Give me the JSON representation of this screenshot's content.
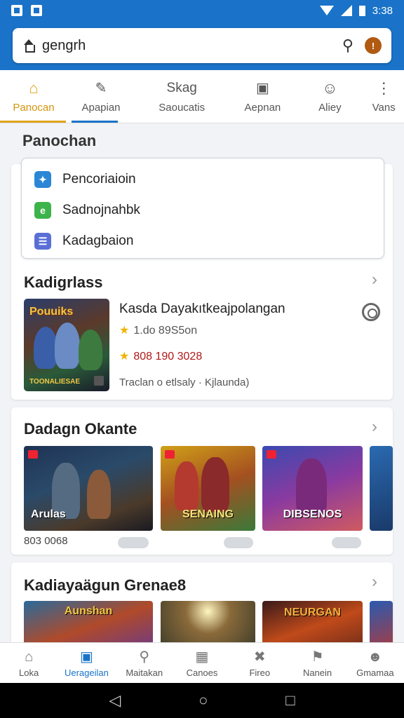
{
  "status_bar": {
    "time": "3:38"
  },
  "search": {
    "value": "gengrh"
  },
  "tabs": [
    {
      "label": "Panocan",
      "icon": "home-icon"
    },
    {
      "label": "Apapian",
      "icon": "doc-edit-icon"
    },
    {
      "label": "Saoucatis",
      "heading": "Skag",
      "icon": "text-icon"
    },
    {
      "label": "Aepnan",
      "icon": "square-icon"
    },
    {
      "label": "Aliey",
      "icon": "smile-icon"
    },
    {
      "label": "Vans",
      "icon": "more-vert-icon"
    }
  ],
  "section_title": "Panochan",
  "menu": [
    {
      "label": "Pencoriaioin",
      "color": "#2b86d6",
      "icon": "app-icon"
    },
    {
      "label": "Sadnojnahbk",
      "color": "#3cb44b",
      "icon": "chat-icon"
    },
    {
      "label": "Kadagbaion",
      "color": "#5a6fd6",
      "icon": "list-icon"
    }
  ],
  "featured": {
    "section": "Kadigrlass",
    "image_title": "Pouuiks",
    "image_bottom": "TOONALIESAE",
    "name": "Kasda Dayakıtkeajpolangan",
    "rating": "1.do 89S5on",
    "price": "808 190 3028",
    "meta": "Traclan o etlsaly · Kjlaunda)"
  },
  "row2": {
    "title": "Dadagn Okante",
    "value": "803 0068",
    "tiles": [
      {
        "title": "Arulas"
      },
      {
        "title": "SENAING"
      },
      {
        "title": "DIBSENOS"
      }
    ]
  },
  "row3": {
    "title": "Kadiayaägun Grenae8",
    "tiles": [
      {
        "title": "Aunshan"
      },
      {
        "title": ""
      },
      {
        "title": "NEURGAN"
      }
    ]
  },
  "bottom_nav": [
    {
      "label": "Loka",
      "icon": "home-icon"
    },
    {
      "label": "Uerageilan",
      "icon": "window-icon"
    },
    {
      "label": "Maitakan",
      "icon": "search-icon"
    },
    {
      "label": "Canoes",
      "icon": "grid-icon"
    },
    {
      "label": "Fireo",
      "icon": "tools-icon"
    },
    {
      "label": "Nanein",
      "icon": "flag-icon"
    },
    {
      "label": "Gmamaa",
      "icon": "person-icon"
    }
  ],
  "colors": {
    "accent": "#1a73c8",
    "home_active": "#e0a41a",
    "price": "#b01818"
  }
}
